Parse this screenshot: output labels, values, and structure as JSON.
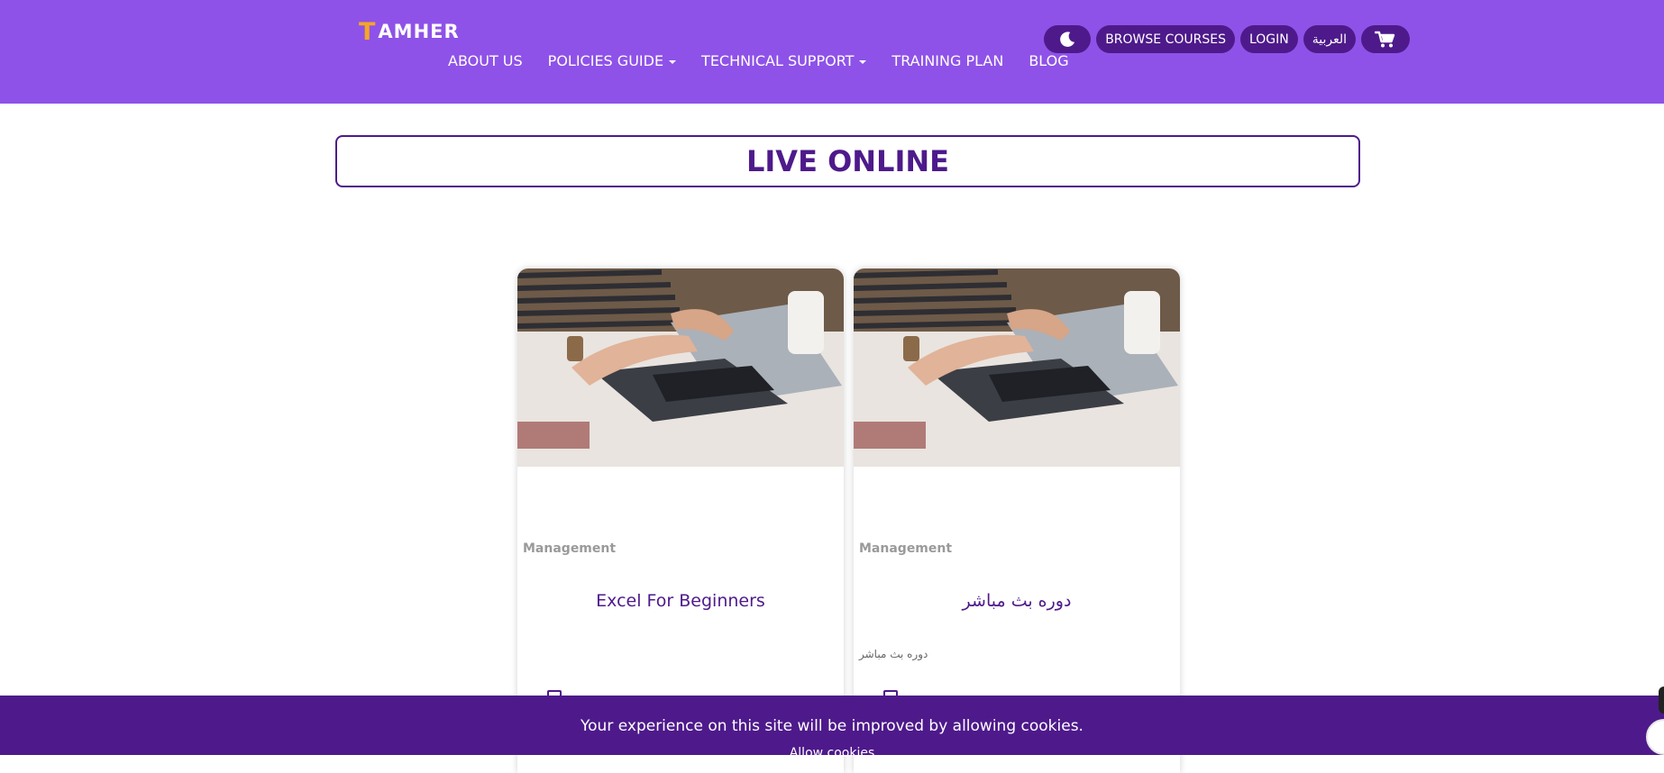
{
  "header": {
    "logo": {
      "first_letter": "T",
      "rest": "AMHER"
    },
    "nav": [
      {
        "label": "ABOUT US",
        "dropdown": false
      },
      {
        "label": "POLICIES GUIDE",
        "dropdown": true
      },
      {
        "label": "TECHNICAL SUPPORT",
        "dropdown": true
      },
      {
        "label": "TRAINING PLAN",
        "dropdown": false
      },
      {
        "label": "BLOG",
        "dropdown": false
      }
    ],
    "buttons": {
      "browse_courses": "BROWSE COURSES",
      "login": "LOGIN",
      "language": "العربية"
    }
  },
  "page": {
    "heading": "LIVE ONLINE"
  },
  "courses": [
    {
      "category": "Management",
      "title": "Excel For Beginners",
      "description": ""
    },
    {
      "category": "Management",
      "title": "دوره بث مباشر",
      "description": "دوره بث مباشر"
    }
  ],
  "cookie_banner": {
    "message": "Your experience on this site will be improved by allowing cookies.",
    "allow_label": "Allow cookies"
  },
  "colors": {
    "header_bg": "#8e52e8",
    "brand_dark": "#4e1a8b",
    "logo_accent": "#f5a623"
  }
}
